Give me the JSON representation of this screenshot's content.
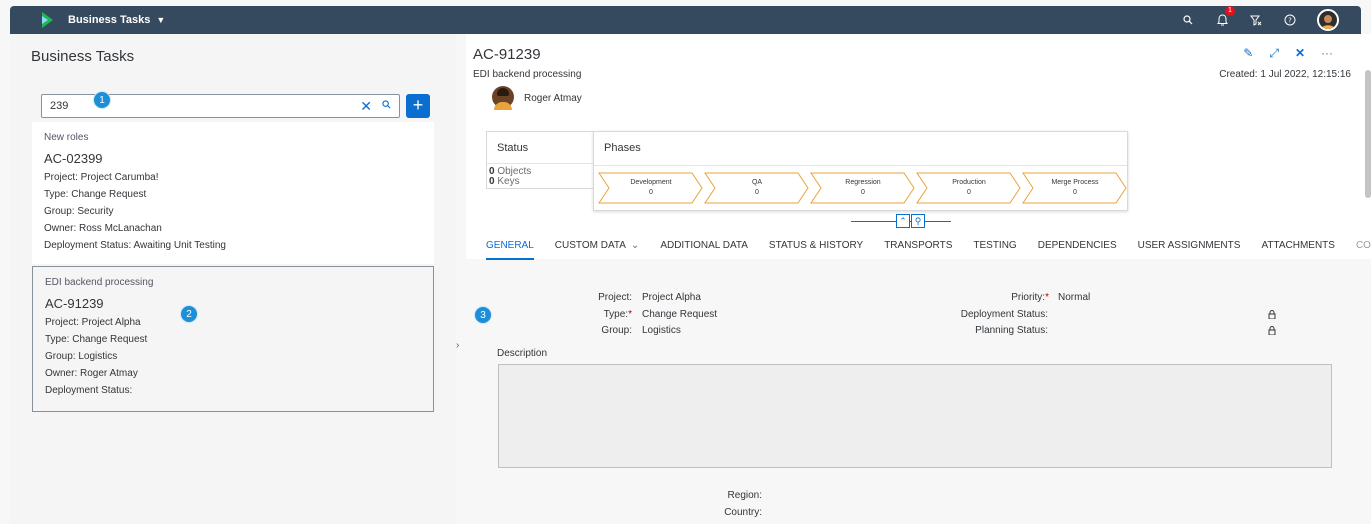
{
  "shell": {
    "app_title": "Business Tasks",
    "notification_count": "1"
  },
  "list": {
    "title": "Business Tasks",
    "search_value": "239",
    "add_label": "+",
    "items": [
      {
        "subtitle": "New roles",
        "id": "AC-02399",
        "project": "Project: Project Carumba!",
        "type": "Type: Change Request",
        "group": "Group: Security",
        "owner": "Owner: Ross McLanachan",
        "deployment": "Deployment Status: Awaiting Unit Testing"
      },
      {
        "subtitle": "EDI backend processing",
        "id": "AC-91239",
        "project": "Project: Project Alpha",
        "type": "Type: Change Request",
        "group": "Group: Logistics",
        "owner": "Owner: Roger Atmay",
        "deployment": "Deployment Status:"
      }
    ]
  },
  "markers": [
    "1",
    "2",
    "3"
  ],
  "detail": {
    "title": "AC-91239",
    "subtitle": "EDI backend processing",
    "created": "Created: 1 Jul 2022, 12:15:16",
    "owner": "Roger Atmay",
    "status": {
      "heading": "Status",
      "objects_count": "0",
      "objects_label": "Objects",
      "keys_count": "0",
      "keys_label": "Keys"
    },
    "phases": {
      "heading": "Phases",
      "items": [
        {
          "name": "Development",
          "count": "0"
        },
        {
          "name": "QA",
          "count": "0"
        },
        {
          "name": "Regression",
          "count": "0"
        },
        {
          "name": "Production",
          "count": "0"
        },
        {
          "name": "Merge Process",
          "count": "0"
        }
      ]
    },
    "tabs": [
      "GENERAL",
      "CUSTOM DATA",
      "ADDITIONAL DATA",
      "STATUS & HISTORY",
      "TRANSPORTS",
      "TESTING",
      "DEPENDENCIES",
      "USER ASSIGNMENTS",
      "ATTACHMENTS",
      "COMM"
    ],
    "form": {
      "project_label": "Project:",
      "project_value": "Project Alpha",
      "type_label": "Type:",
      "type_value": "Change Request",
      "group_label": "Group:",
      "group_value": "Logistics",
      "priority_label": "Priority:",
      "priority_value": "Normal",
      "deployment_label": "Deployment Status:",
      "planning_label": "Planning Status:",
      "description_label": "Description",
      "region_label": "Region:",
      "country_label": "Country:",
      "required_mark": "*"
    }
  },
  "colors": {
    "shell": "#354a5f",
    "accent": "#0a6ed1",
    "marker": "#1c8fd8",
    "phase_arrow": "#e9a23b"
  }
}
